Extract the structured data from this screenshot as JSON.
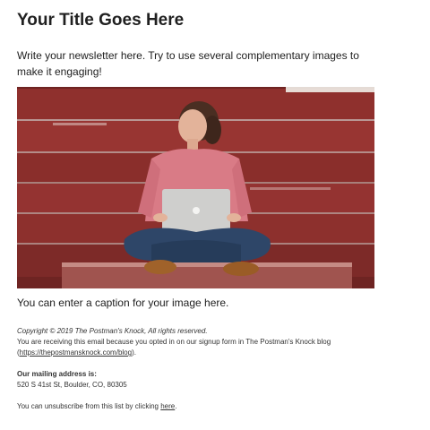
{
  "header": {
    "title": "Your Title Goes Here"
  },
  "body": {
    "intro": "Write your newsletter here. Try to use several complementary images to make it engaging!",
    "caption": "You can enter a caption for your image here."
  },
  "footer": {
    "copyright": "Copyright © 2019 The Postman's Knock, All rights reserved.",
    "reason": "You are receiving this email because you opted in on our signup form in The Postman's Knock blog",
    "blog_link_open": "(",
    "blog_link_text": "https://thepostmansknock.com/blog",
    "blog_link_close": ").",
    "mailing_label": "Our mailing address is:",
    "mailing_address": "520 S 41st St, Boulder, CO, 80305",
    "unsubscribe_prefix": "You can unsubscribe from this list by clicking ",
    "unsubscribe_link": "here",
    "unsubscribe_suffix": "."
  },
  "colors": {
    "text": "#202020",
    "fence": "#8b2f2c",
    "shirt": "#d97b86",
    "jeans": "#2e4668"
  }
}
